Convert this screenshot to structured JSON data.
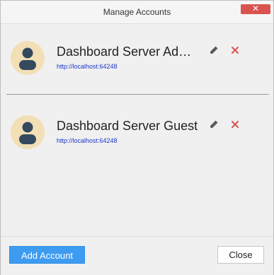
{
  "window": {
    "title": "Manage Accounts",
    "close_symbol": "✕"
  },
  "accounts": [
    {
      "name": "Dashboard Server Administrator",
      "url": "http://localhost:64248",
      "avatar_icon": "user-avatar-icon",
      "edit_icon": "pencil-icon",
      "delete_icon": "close-icon"
    },
    {
      "name": "Dashboard Server Guest",
      "url": "http://localhost:64248",
      "avatar_icon": "user-avatar-icon",
      "edit_icon": "pencil-icon",
      "delete_icon": "close-icon"
    }
  ],
  "footer": {
    "add_label": "Add Account",
    "close_label": "Close"
  },
  "colors": {
    "accent": "#3d9cf0",
    "danger": "#d9534f",
    "avatar_bg": "#f2dfb5",
    "avatar_figure": "#34495e",
    "link": "#1a37c8"
  }
}
